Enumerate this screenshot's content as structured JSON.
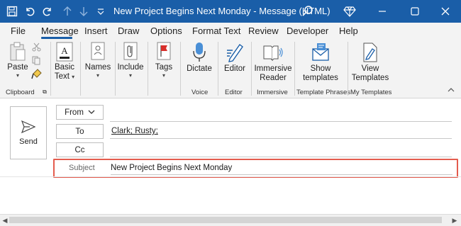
{
  "window": {
    "title": "New Project Begins Next Monday  -  Message (HTML)",
    "accent_color": "#1a5ea8"
  },
  "menu": {
    "items": [
      "File",
      "Message",
      "Insert",
      "Draw",
      "Options",
      "Format Text",
      "Review",
      "Developer",
      "Help"
    ],
    "active": "Message"
  },
  "ribbon": {
    "clipboard": {
      "paste_label": "Paste",
      "group_label": "Clipboard"
    },
    "basic_text": {
      "label_line1": "Basic",
      "label_line2": "Text"
    },
    "names": {
      "label": "Names"
    },
    "include": {
      "label": "Include"
    },
    "tags": {
      "label": "Tags"
    },
    "voice": {
      "dictate_label": "Dictate",
      "group_label": "Voice"
    },
    "editor": {
      "editor_label": "Editor",
      "group_label": "Editor"
    },
    "immersive": {
      "label_line1": "Immersive",
      "label_line2": "Reader",
      "group_label": "Immersive"
    },
    "template_phrases": {
      "label_line1": "Show",
      "label_line2": "templates",
      "group_label": "Template Phrases"
    },
    "my_templates": {
      "label_line1": "View",
      "label_line2": "Templates",
      "group_label": "My Templates"
    }
  },
  "compose": {
    "send_label": "Send",
    "from_label": "From",
    "to_label": "To",
    "cc_label": "Cc",
    "to_value": "Clark; Rusty;",
    "to_recipients": [
      "Clark",
      "Rusty"
    ],
    "subject_label": "Subject",
    "subject_value": "New Project Begins Next Monday"
  }
}
